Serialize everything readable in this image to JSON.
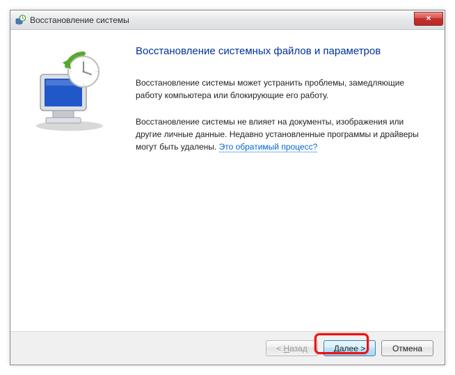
{
  "window": {
    "title": "Восстановление системы"
  },
  "content": {
    "heading": "Восстановление системных файлов и параметров",
    "para1": "Восстановление системы может устранить проблемы, замедляющие работу компьютера или блокирующие его работу.",
    "para2_before": "Восстановление системы не влияет на документы, изображения или другие личные данные. Недавно установленные программы и драйверы могут быть удалены. ",
    "para2_link": "Это обратимый процесс?"
  },
  "buttons": {
    "back_prefix": "< ",
    "back_hotkey": "Н",
    "back_suffix": "азад",
    "next_hotkey": "Д",
    "next_suffix": "алее >",
    "cancel": "Отмена"
  },
  "icons": {
    "titlebar": "system-restore",
    "close": "×"
  }
}
